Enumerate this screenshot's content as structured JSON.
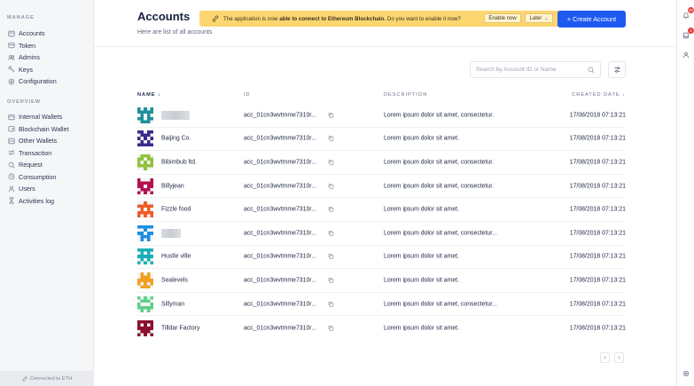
{
  "sidebar": {
    "sections": [
      {
        "title": "MANAGE",
        "items": [
          {
            "label": "Accounts",
            "icon": "accounts-icon"
          },
          {
            "label": "Token",
            "icon": "token-icon"
          },
          {
            "label": "Admins",
            "icon": "admins-icon"
          },
          {
            "label": "Keys",
            "icon": "key-icon"
          },
          {
            "label": "Configuration",
            "icon": "gear-icon"
          }
        ]
      },
      {
        "title": "OVERVIEW",
        "items": [
          {
            "label": "Internal Wallets",
            "icon": "wallet-icon"
          },
          {
            "label": "Blockchain Wallet",
            "icon": "blockchain-wallet-icon"
          },
          {
            "label": "Other Wallets",
            "icon": "wallet-icon"
          },
          {
            "label": "Transaction",
            "icon": "transaction-icon"
          },
          {
            "label": "Request",
            "icon": "request-icon"
          },
          {
            "label": "Consumption",
            "icon": "consumption-icon"
          },
          {
            "label": "Users",
            "icon": "users-icon"
          },
          {
            "label": "Activities log",
            "icon": "hourglass-icon"
          }
        ]
      }
    ],
    "footer": "Connected to ETH"
  },
  "rail": {
    "notification_count": "20",
    "inbox_count": "1"
  },
  "header": {
    "title": "Accounts",
    "subtitle": "Here are list of all accounts",
    "create_button": "+ Create Account"
  },
  "notice": {
    "prefix": "The application is now",
    "bold": "able to connect to Ethereum Blockchain.",
    "suffix": "Do you want to enable it now?",
    "enable_label": "Enable now",
    "later_label": "Later"
  },
  "search": {
    "placeholder": "Search by Account ID or Name"
  },
  "table": {
    "columns": {
      "name": "NAME ↓",
      "id": "ID",
      "description": "DESCRIPTION",
      "created": "CREATED DATE ↓"
    },
    "rows": [
      {
        "name": "",
        "id": "acc_01cn3wvtmme7310r...",
        "description": "Lorem ipsum dolor sit amet, consectetur.",
        "date": "17/08/2018 07:13:21",
        "color": "#1f8f9a"
      },
      {
        "name": "Baijing Co.",
        "id": "acc_01cn3wvtmme7310r...",
        "description": "Lorem ipsum dolor sit amet.",
        "date": "17/08/2018 07:13:21",
        "color": "#3b2a8c"
      },
      {
        "name": "Bibimbub ltd.",
        "id": "acc_01cn3wvtmme7310r...",
        "description": "Lorem ipsum dolor sit amet, consectetur.",
        "date": "17/08/2018 07:13:21",
        "color": "#8fc23a"
      },
      {
        "name": "Billyjean",
        "id": "acc_01cn3wvtmme7310r...",
        "description": "Lorem ipsum dolor sit amet, consectetur.",
        "date": "17/08/2018 07:13:21",
        "color": "#b0124e"
      },
      {
        "name": "Fizzle food",
        "id": "acc_01cn3wvtmme7310r...",
        "description": "Lorem ipsum dolor sit amet.",
        "date": "17/08/2018 07:13:21",
        "color": "#f05a28"
      },
      {
        "name": "",
        "id": "acc_01cn3wvtmme7310r...",
        "description": "Lorem ipsum dolor sit amet, consectetur...",
        "date": "17/08/2018 07:13:21",
        "color": "#1b8fe0"
      },
      {
        "name": "Hustle ville",
        "id": "acc_01cn3wvtmme7310r...",
        "description": "Lorem ipsum dolor sit amet.",
        "date": "17/08/2018 07:13:21",
        "color": "#18b0b5"
      },
      {
        "name": "Sealevels",
        "id": "acc_01cn3wvtmme7310r...",
        "description": "Lorem ipsum dolor sit amet.",
        "date": "17/08/2018 07:13:21",
        "color": "#f2a020"
      },
      {
        "name": "Sillyman",
        "id": "acc_01cn3wvtmme7310r...",
        "description": "Lorem ipsum dolor sit amet, consectetur...",
        "date": "17/08/2018 07:13:21",
        "color": "#5fcf8a"
      },
      {
        "name": "Tilldar Factory",
        "id": "acc_01cn3wvtmme7310r...",
        "description": "Lorem ipsum dolor sit amet.",
        "date": "17/08/2018 07:13:21",
        "color": "#8a1030"
      }
    ]
  },
  "pagination": {
    "prev": "‹",
    "next": "›"
  }
}
